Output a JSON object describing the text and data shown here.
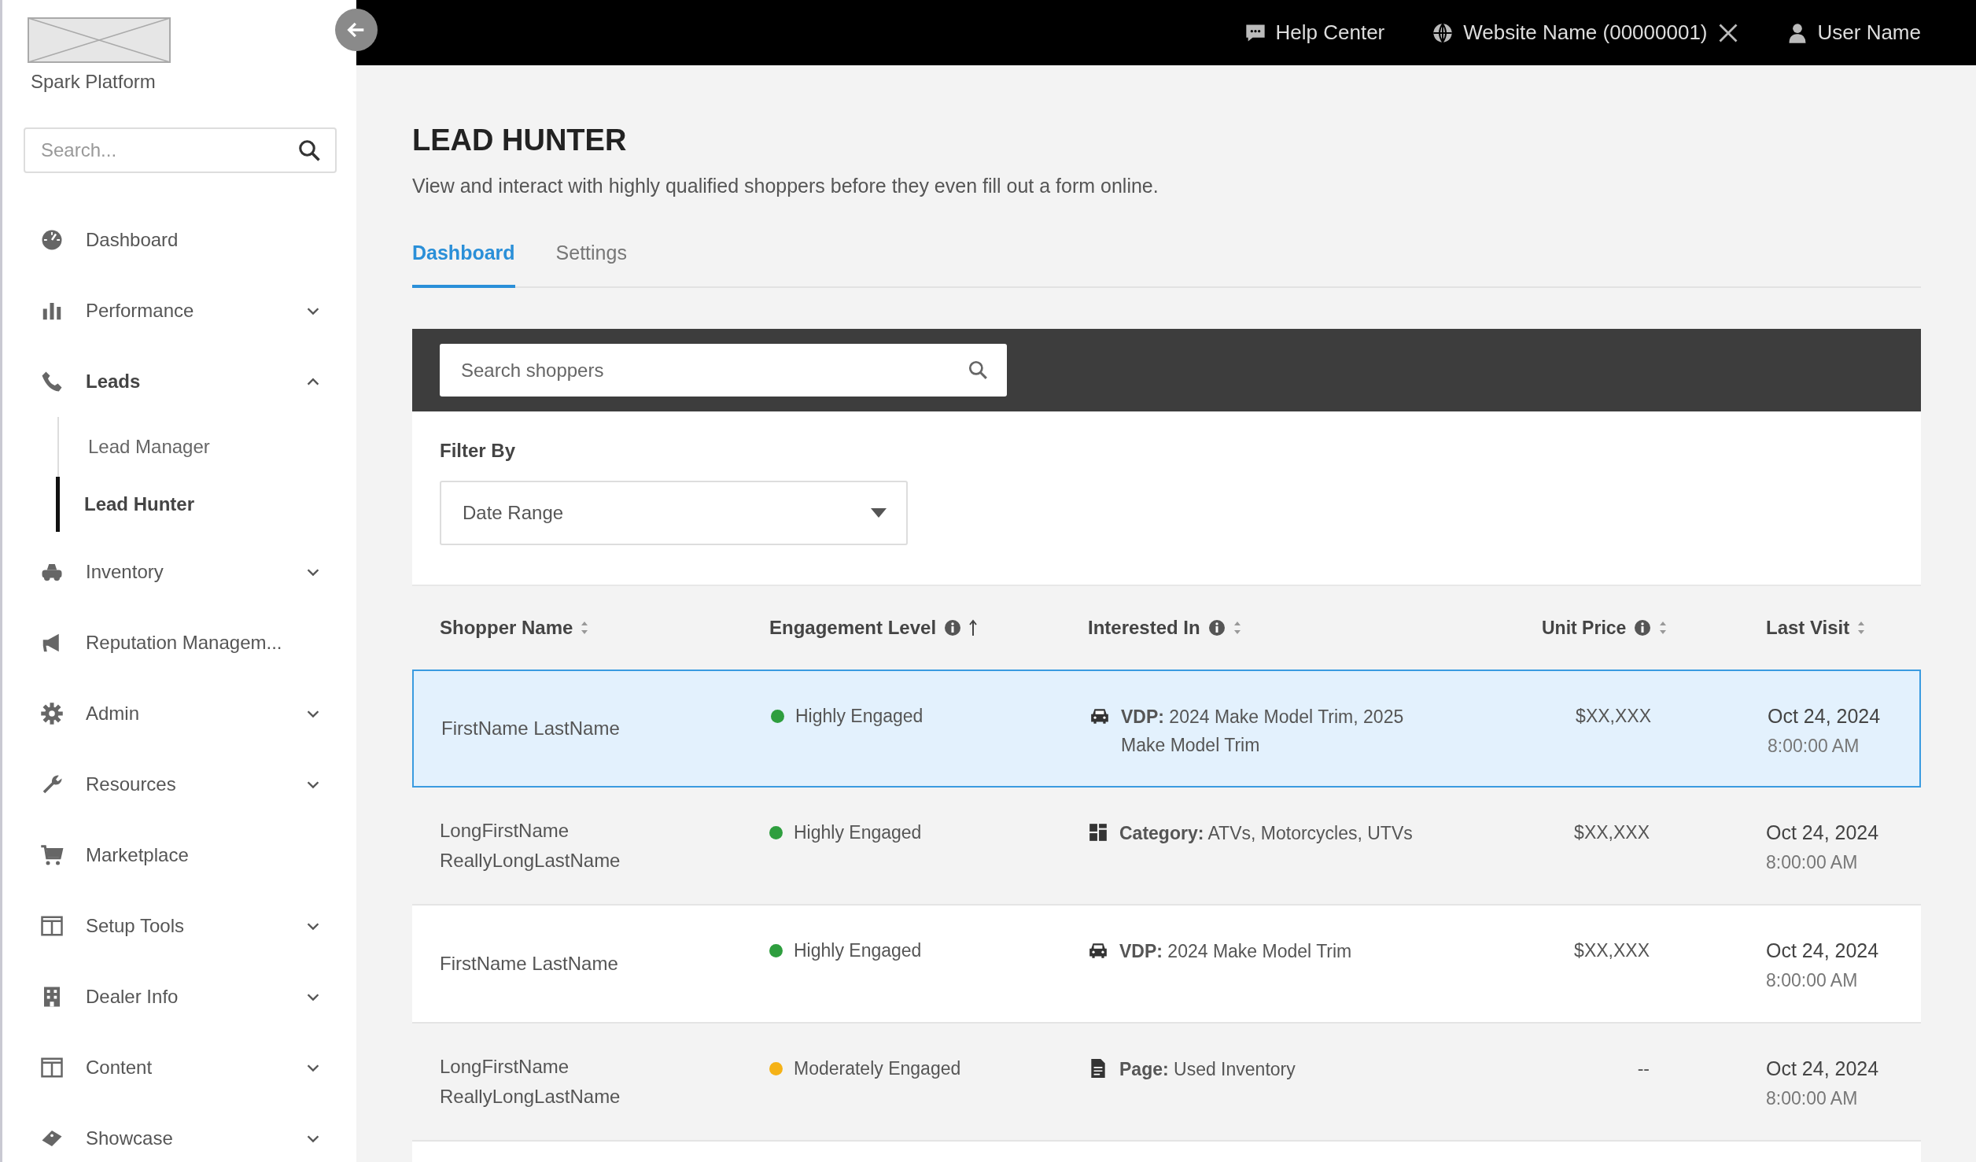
{
  "sidebar": {
    "brand": "Spark Platform",
    "search": {
      "placeholder": "Search..."
    },
    "items": [
      {
        "label": "Dashboard",
        "kind": "link",
        "expanded": false
      },
      {
        "label": "Performance",
        "kind": "group",
        "expanded": false
      },
      {
        "label": "Leads",
        "kind": "group",
        "expanded": true,
        "children": [
          {
            "label": "Lead Manager",
            "selected": false
          },
          {
            "label": "Lead Hunter",
            "selected": true
          }
        ]
      },
      {
        "label": "Inventory",
        "kind": "group",
        "expanded": false
      },
      {
        "label": "Reputation Managem...",
        "kind": "link",
        "expanded": false
      },
      {
        "label": "Admin",
        "kind": "group",
        "expanded": false
      },
      {
        "label": "Resources",
        "kind": "group",
        "expanded": false
      },
      {
        "label": "Marketplace",
        "kind": "link",
        "expanded": false
      },
      {
        "label": "Setup Tools",
        "kind": "group",
        "expanded": false
      },
      {
        "label": "Dealer Info",
        "kind": "group",
        "expanded": false
      },
      {
        "label": "Content",
        "kind": "group",
        "expanded": false
      },
      {
        "label": "Showcase",
        "kind": "group",
        "expanded": false
      }
    ]
  },
  "top_bar": {
    "help": "Help Center",
    "website": "Website Name (00000001)",
    "user": "User Name"
  },
  "page": {
    "title": "LEAD HUNTER",
    "subtitle": "View and interact with highly qualified shoppers before they even fill out a form online.",
    "tabs": [
      {
        "label": "Dashboard",
        "selected": true
      },
      {
        "label": "Settings",
        "selected": false
      }
    ]
  },
  "shopper_search": {
    "placeholder": "Search shoppers"
  },
  "filter": {
    "label": "Filter By",
    "dropdown": "Date Range"
  },
  "table": {
    "columns": [
      {
        "label": "Shopper Name",
        "info": false,
        "sorted": false
      },
      {
        "label": "Engagement Level",
        "info": true,
        "sorted": true
      },
      {
        "label": "Interested In",
        "info": true,
        "sorted": false
      },
      {
        "label": "Unit Price",
        "info": true,
        "sorted": false
      },
      {
        "label": "Last Visit",
        "info": false,
        "sorted": false
      }
    ],
    "rows": [
      {
        "selected": true,
        "name": "FirstName LastName",
        "engagement": "Highly Engaged",
        "color": "#2e9e3e",
        "kind": "vehicle",
        "interest": "**VDP:** 2024 Make Model Trim, 2025 Make Model Trim",
        "price": "$XX,XXX",
        "date": "Oct 24, 2024",
        "time": "8:00:00 AM"
      },
      {
        "selected": false,
        "name": "LongFirstName ReallyLongLastName",
        "engagement": "Highly Engaged",
        "color": "#2e9e3e",
        "kind": "category",
        "interest": "**Category:** ATVs, Motorcycles, UTVs",
        "price": "$XX,XXX",
        "date": "Oct 24, 2024",
        "time": "8:00:00 AM"
      },
      {
        "selected": false,
        "name": "FirstName LastName",
        "engagement": "Highly Engaged",
        "color": "#2e9e3e",
        "kind": "vehicle",
        "interest": "**VDP:** 2024 Make Model Trim",
        "price": "$XX,XXX",
        "date": "Oct 24, 2024",
        "time": "8:00:00 AM"
      },
      {
        "selected": false,
        "name": "LongFirstName ReallyLongLastName",
        "engagement": "Moderately Engaged",
        "color": "#f5b216",
        "kind": "page",
        "interest": "**Page:** Used Inventory",
        "price": "--",
        "date": "Oct 24, 2024",
        "time": "8:00:00 AM"
      }
    ]
  }
}
